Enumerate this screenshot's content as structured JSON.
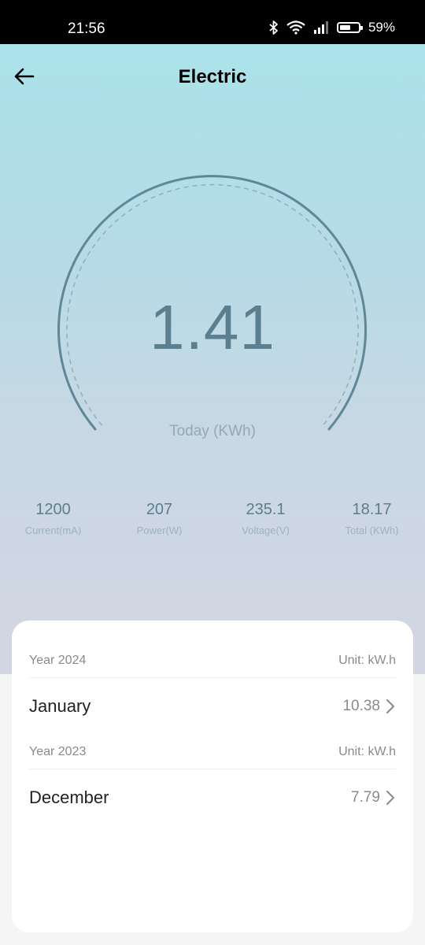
{
  "status_bar": {
    "time": "21:56",
    "battery_percent": "59%",
    "icons": [
      "bluetooth-icon",
      "wifi-icon",
      "signal-icon",
      "battery-icon"
    ]
  },
  "header": {
    "title": "Electric",
    "back_icon": "arrow-left-icon"
  },
  "gauge": {
    "value": "1.41",
    "label": "Today (KWh)"
  },
  "stats": [
    {
      "value": "1200",
      "label": "Current(mA)"
    },
    {
      "value": "207",
      "label": "Power(W)"
    },
    {
      "value": "235.1",
      "label": "Voltage(V)"
    },
    {
      "value": "18.17",
      "label": "Total (KWh)"
    }
  ],
  "history": [
    {
      "year": "Year 2024",
      "unit": "Unit: kW.h",
      "month": "January",
      "value": "10.38"
    },
    {
      "year": "Year 2023",
      "unit": "Unit: kW.h",
      "month": "December",
      "value": "7.79"
    }
  ],
  "colors": {
    "gauge_stroke": "#5f8797",
    "gauge_text": "#5b7f8e",
    "gradient_top": "#a8e4ec",
    "gradient_bottom": "#d3d6e2"
  }
}
